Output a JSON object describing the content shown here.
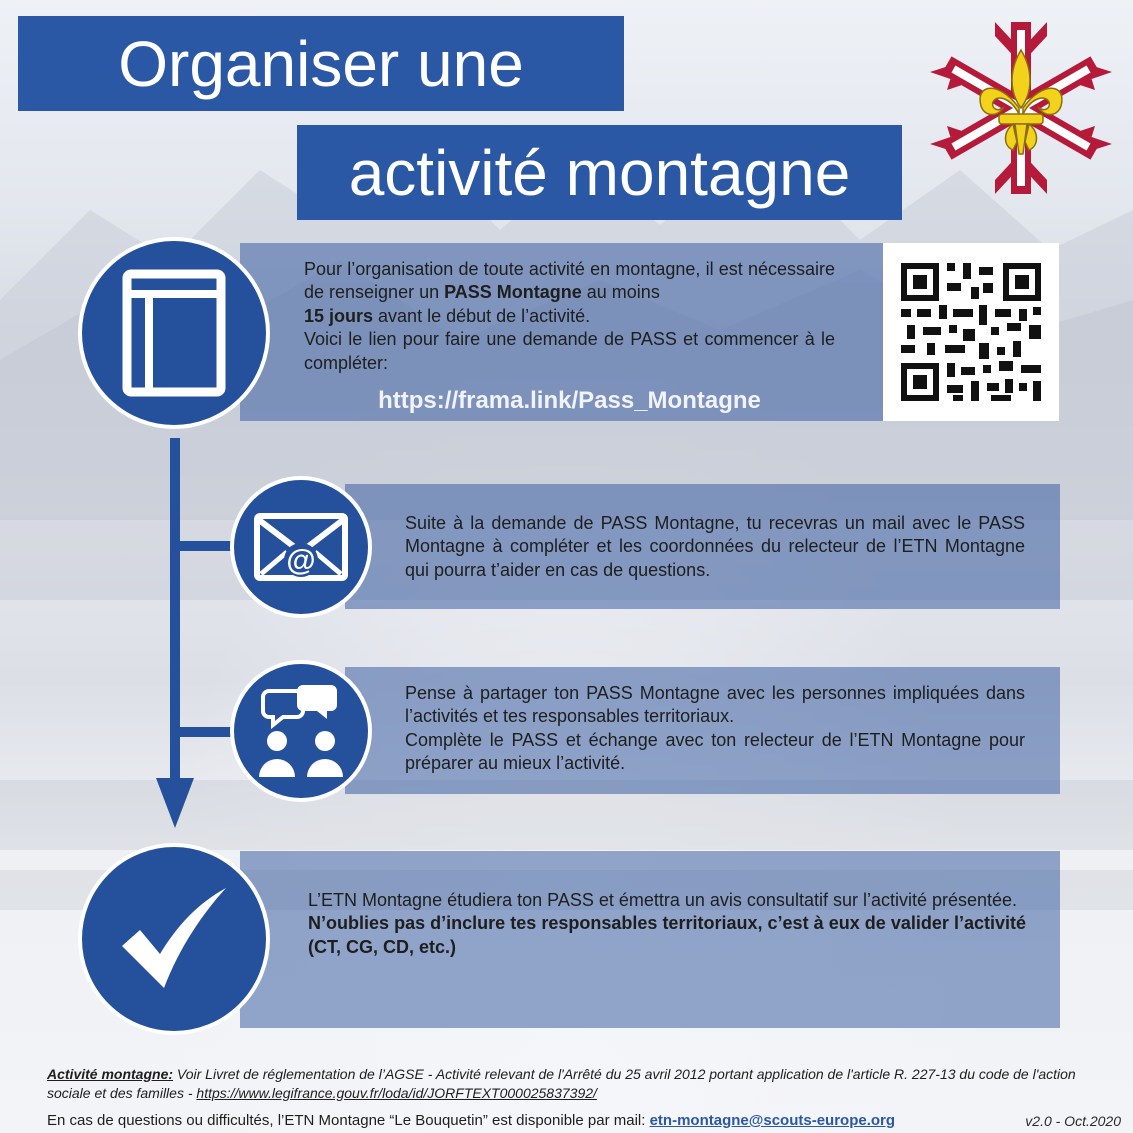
{
  "title": {
    "line1": "Organiser une",
    "line2": "activité montagne"
  },
  "colors": {
    "primary": "#2b58a5",
    "panel": "#5a7dbd",
    "logo_red": "#b51a3a",
    "logo_yellow": "#f3d21c"
  },
  "steps": [
    {
      "icon": "form-window-icon",
      "text_1": "Pour l’organisation de toute activité en montagne, il est nécessaire de renseigner un ",
      "bold_1": "PASS Montagne",
      "text_2": " au moins ",
      "bold_2": "15 jours",
      "text_3": " avant le début de l’activité.",
      "text_4": "Voici le lien pour faire une demande de PASS et commencer à le compléter:",
      "link": "https://frama.link/Pass_Montagne",
      "qr_icon": "qr-code-icon"
    },
    {
      "icon": "email-at-icon",
      "text": "Suite à la demande de PASS Montagne, tu recevras un mail avec le PASS Montagne à compléter et les coordonnées du relecteur de l’ETN Montagne qui pourra t’aider en cas de questions."
    },
    {
      "icon": "people-chat-icon",
      "text_1": "Pense à partager ton PASS Montagne avec les personnes impliquées dans l’activités et tes responsables territoriaux.",
      "text_2": "Complète le PASS et échange avec ton relecteur de l’ETN Montagne pour préparer au mieux l’activité."
    },
    {
      "icon": "checkmark-icon",
      "text_1": "L’ETN Montagne étudiera ton PASS et émettra un avis consultatif sur l’activité présentée.",
      "bold_1": "N’oublies pas d’inclure tes responsables territoriaux, c’est à eux de valider l’activité (CT, CG, CD, etc.)"
    }
  ],
  "footer": {
    "label": "Activité montagne:",
    "note": " Voir Livret de réglementation de l’AGSE - Activité relevant de l'Arrêté du 25 avril 2012 portant application de l'article R. 227-13 du code de l'action sociale et des familles - ",
    "legal_link": "https://www.legifrance.gouv.fr/loda/id/JORFTEXT000025837392/",
    "contact_text": "En cas de questions ou difficultés, l’ETN Montagne “Le Bouquetin” est disponible par mail: ",
    "email": "etn-montagne@scouts-europe.org",
    "version": "v2.0 - Oct.2020"
  }
}
